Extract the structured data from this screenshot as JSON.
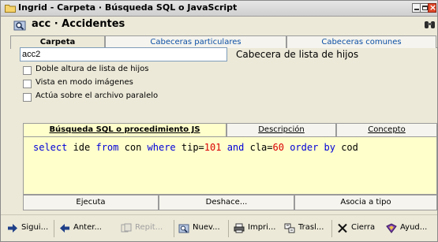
{
  "window": {
    "title": "Ingrid - Carpeta · Búsqueda SQL o JavaScript"
  },
  "header": {
    "title": "acc · Accidentes"
  },
  "top_tabs": [
    {
      "label": "Carpeta",
      "active": true
    },
    {
      "label": "Cabeceras particulares",
      "active": false
    },
    {
      "label": "Cabeceras comunes",
      "active": false
    }
  ],
  "child_list": {
    "value": "acc2",
    "label": "Cabecera de lista de hijos"
  },
  "options": [
    {
      "label": "Doble altura de lista de hijos",
      "checked": false
    },
    {
      "label": "Vista en modo imágenes",
      "checked": false
    },
    {
      "label": "Actúa sobre el archivo paralelo",
      "checked": false
    }
  ],
  "inner_tabs": [
    {
      "label": "Búsqueda SQL o procedimiento JS",
      "active": true
    },
    {
      "label": "Descripción",
      "active": false
    },
    {
      "label": "Concepto",
      "active": false
    }
  ],
  "sql": {
    "tokens": [
      {
        "t": "select",
        "c": "kw"
      },
      {
        "t": " ide ",
        "c": ""
      },
      {
        "t": "from",
        "c": "kw"
      },
      {
        "t": " con ",
        "c": ""
      },
      {
        "t": "where",
        "c": "kw"
      },
      {
        "t": " tip=",
        "c": ""
      },
      {
        "t": "101",
        "c": "num"
      },
      {
        "t": " ",
        "c": ""
      },
      {
        "t": "and",
        "c": "kw"
      },
      {
        "t": " cla=",
        "c": ""
      },
      {
        "t": "60",
        "c": "num"
      },
      {
        "t": " ",
        "c": ""
      },
      {
        "t": "order by",
        "c": "kw"
      },
      {
        "t": " cod",
        "c": ""
      }
    ]
  },
  "actions": {
    "execute": "Ejecuta",
    "undo": "Deshace...",
    "assign": "Asocia a tipo"
  },
  "toolbar": {
    "next": "Sigui...",
    "prev": "Anter...",
    "repeat": "Repit...",
    "new": "Nuev...",
    "print": "Impri...",
    "transfer": "Trasl...",
    "close": "Cierra",
    "help": "Ayud..."
  },
  "colors": {
    "keyword": "#0000d8",
    "number": "#d80000",
    "sql_background": "#ffffcc",
    "tab_link": "#0c4fa5"
  }
}
